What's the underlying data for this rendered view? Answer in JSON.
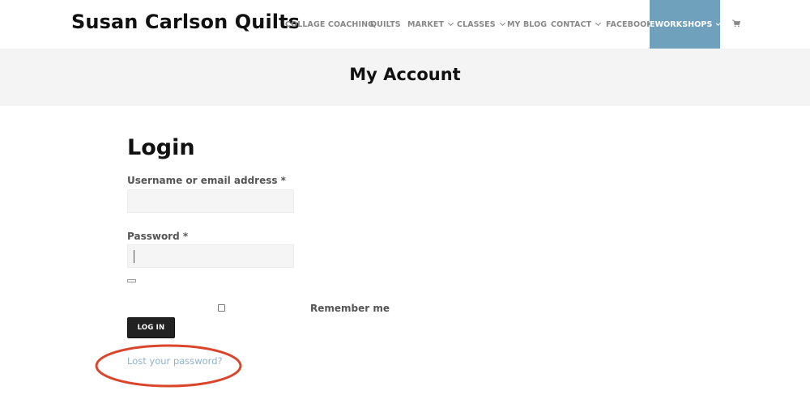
{
  "site": {
    "title": "Susan Carlson Quilts"
  },
  "nav": {
    "items": [
      {
        "label": "COLLAGE COACHING",
        "has_dropdown": false
      },
      {
        "label": "QUILTS",
        "has_dropdown": false
      },
      {
        "label": "MARKET",
        "has_dropdown": true
      },
      {
        "label": "CLASSES",
        "has_dropdown": true
      },
      {
        "label": "MY BLOG",
        "has_dropdown": false
      },
      {
        "label": "CONTACT",
        "has_dropdown": true
      },
      {
        "label": "FACEBOOK",
        "has_dropdown": false
      },
      {
        "label": "EWORKSHOPS",
        "has_dropdown": true,
        "active": true
      }
    ],
    "cart_icon": "cart-icon"
  },
  "page": {
    "heading": "My Account"
  },
  "login": {
    "title": "Login",
    "username_label": "Username or email address *",
    "username_value": "",
    "password_label": "Password *",
    "password_value": "",
    "remember_label": "Remember me",
    "remember_checked": false,
    "submit_label": "LOG IN",
    "lost_password_label": "Lost your password?"
  },
  "annotation": {
    "shape": "ellipse",
    "color": "#d9462b",
    "target": "lost-password-link"
  },
  "colors": {
    "accent": "#6fa1bd",
    "link": "#8fb3c9",
    "banner_bg": "#f4f4f4",
    "button_bg": "#222222"
  }
}
